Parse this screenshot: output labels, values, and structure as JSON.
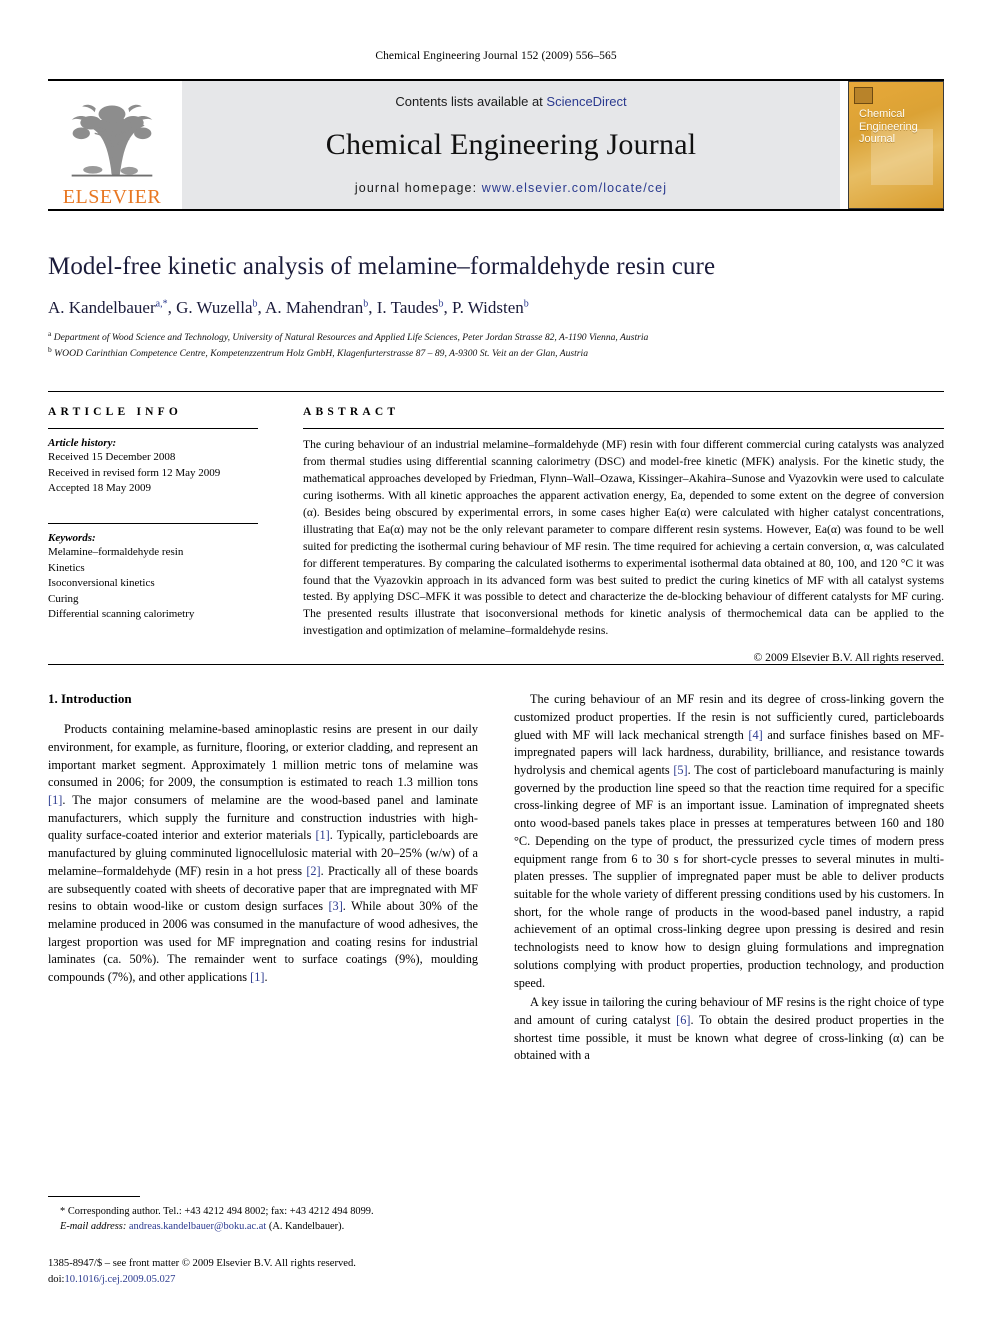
{
  "running_head": "Chemical Engineering Journal 152 (2009) 556–565",
  "masthead": {
    "publisher_name": "ELSEVIER",
    "contents_prefix": "Contents lists available at",
    "sciencedirect": "ScienceDirect",
    "journal_name": "Chemical Engineering Journal",
    "homepage_label": "journal homepage:",
    "homepage_url": "www.elsevier.com/locate/cej",
    "cover_title_line1": "Chemical",
    "cover_title_line2": "Engineering",
    "cover_title_line3": "Journal"
  },
  "article": {
    "title": "Model-free kinetic analysis of melamine–formaldehyde resin cure",
    "authors": "A. Kandelbauer a,*, G. Wuzella b, A. Mahendran b, I. Taudes b, P. Widsten b",
    "affiliation_a": "Department of Wood Science and Technology, University of Natural Resources and Applied Life Sciences, Peter Jordan Strasse 82, A-1190 Vienna, Austria",
    "affiliation_b": "WOOD Carinthian Competence Centre, Kompetenzzentrum Holz GmbH, Klagenfurterstrasse 87 – 89, A-9300 St. Veit an der Glan, Austria"
  },
  "article_info": {
    "heading": "ARTICLE INFO",
    "history_label": "Article history:",
    "history": [
      "Received 15 December 2008",
      "Received in revised form 12 May 2009",
      "Accepted 18 May 2009"
    ],
    "keywords_label": "Keywords:",
    "keywords": [
      "Melamine–formaldehyde resin",
      "Kinetics",
      "Isoconversional kinetics",
      "Curing",
      "Differential scanning calorimetry"
    ]
  },
  "abstract": {
    "heading": "ABSTRACT",
    "text": "The curing behaviour of an industrial melamine–formaldehyde (MF) resin with four different commercial curing catalysts was analyzed from thermal studies using differential scanning calorimetry (DSC) and model-free kinetic (MFK) analysis. For the kinetic study, the mathematical approaches developed by Friedman, Flynn–Wall–Ozawa, Kissinger–Akahira–Sunose and Vyazovkin were used to calculate curing isotherms. With all kinetic approaches the apparent activation energy, Ea, depended to some extent on the degree of conversion (α). Besides being obscured by experimental errors, in some cases higher Ea(α) were calculated with higher catalyst concentrations, illustrating that Ea(α) may not be the only relevant parameter to compare different resin systems. However, Ea(α) was found to be well suited for predicting the isothermal curing behaviour of MF resin. The time required for achieving a certain conversion, α, was calculated for different temperatures. By comparing the calculated isotherms to experimental isothermal data obtained at 80, 100, and 120 °C it was found that the Vyazovkin approach in its advanced form was best suited to predict the curing kinetics of MF with all catalyst systems tested. By applying DSC–MFK it was possible to detect and characterize the de-blocking behaviour of different catalysts for MF curing. The presented results illustrate that isoconversional methods for kinetic analysis of thermochemical data can be applied to the investigation and optimization of melamine–formaldehyde resins.",
    "copyright": "© 2009 Elsevier B.V. All rights reserved."
  },
  "body": {
    "section_number_title": "1. Introduction",
    "left_paragraph_1_parts": [
      "Products containing melamine-based aminoplastic resins are present in our daily environment, for example, as furniture, flooring, or exterior cladding, and represent an important market segment. Approximately 1 million metric tons of melamine was consumed in 2006; for 2009, the consumption is estimated to reach 1.3 million tons ",
      "[1]",
      ". The major consumers of melamine are the wood-based panel and laminate manufacturers, which supply the furniture and construction industries with high-quality surface-coated interior and exterior materials ",
      "[1]",
      ". Typically, particleboards are manufactured by gluing comminuted lignocellulosic material with 20–25% (w/w) of a melamine–formaldehyde (MF) resin in a hot press ",
      "[2]",
      ". Practically all of these boards are subsequently coated with sheets of decorative paper that are impregnated with MF resins to obtain wood-like or custom design surfaces ",
      "[3]",
      ". While about 30% of the melamine produced in 2006 was consumed in the manufacture of wood adhesives, the largest proportion was used for MF impregnation and coating resins for industrial laminates (ca. 50%). The remainder went to surface coatings (9%), moulding compounds (7%), and other applications ",
      "[1]",
      "."
    ],
    "right_paragraph_1_parts": [
      "The curing behaviour of an MF resin and its degree of cross-linking govern the customized product properties. If the resin is not sufficiently cured, particleboards glued with MF will lack mechanical strength ",
      "[4]",
      " and surface finishes based on MF-impregnated papers will lack hardness, durability, brilliance, and resistance towards hydrolysis and chemical agents ",
      "[5]",
      ". The cost of particleboard manufacturing is mainly governed by the production line speed so that the reaction time required for a specific cross-linking degree of MF is an important issue. Lamination of impregnated sheets onto wood-based panels takes place in presses at temperatures between 160 and 180 °C. Depending on the type of product, the pressurized cycle times of modern press equipment range from 6 to 30 s for short-cycle presses to several minutes in multi-platen presses. The supplier of impregnated paper must be able to deliver products suitable for the whole variety of different pressing conditions used by his customers. In short, for the whole range of products in the wood-based panel industry, a rapid achievement of an optimal cross-linking degree upon pressing is desired and resin technologists need to know how to design gluing formulations and impregnation solutions complying with product properties, production technology, and production speed."
    ],
    "right_paragraph_2_parts": [
      "A key issue in tailoring the curing behaviour of MF resins is the right choice of type and amount of curing catalyst ",
      "[6]",
      ". To obtain the desired product properties in the shortest time possible, it must be known what degree of cross-linking (α) can be obtained with a"
    ]
  },
  "footnotes": {
    "corresponding_marker": "*",
    "corresponding_text": "Corresponding author. Tel.: +43 4212 494 8002; fax: +43 4212 494 8099.",
    "email_label": "E-mail address:",
    "email": "andreas.kandelbauer@boku.ac.at",
    "email_suffix": "(A. Kandelbauer).",
    "issn_line": "1385-8947/$ – see front matter © 2009 Elsevier B.V. All rights reserved.",
    "doi_label": "doi:",
    "doi_value": "10.1016/j.cej.2009.05.027"
  },
  "colors": {
    "elsevier_orange": "#E87722",
    "link_blue": "#2b3a8f",
    "banner_gray": "#e6e7e9",
    "title_navy": "#1b1b3a"
  }
}
